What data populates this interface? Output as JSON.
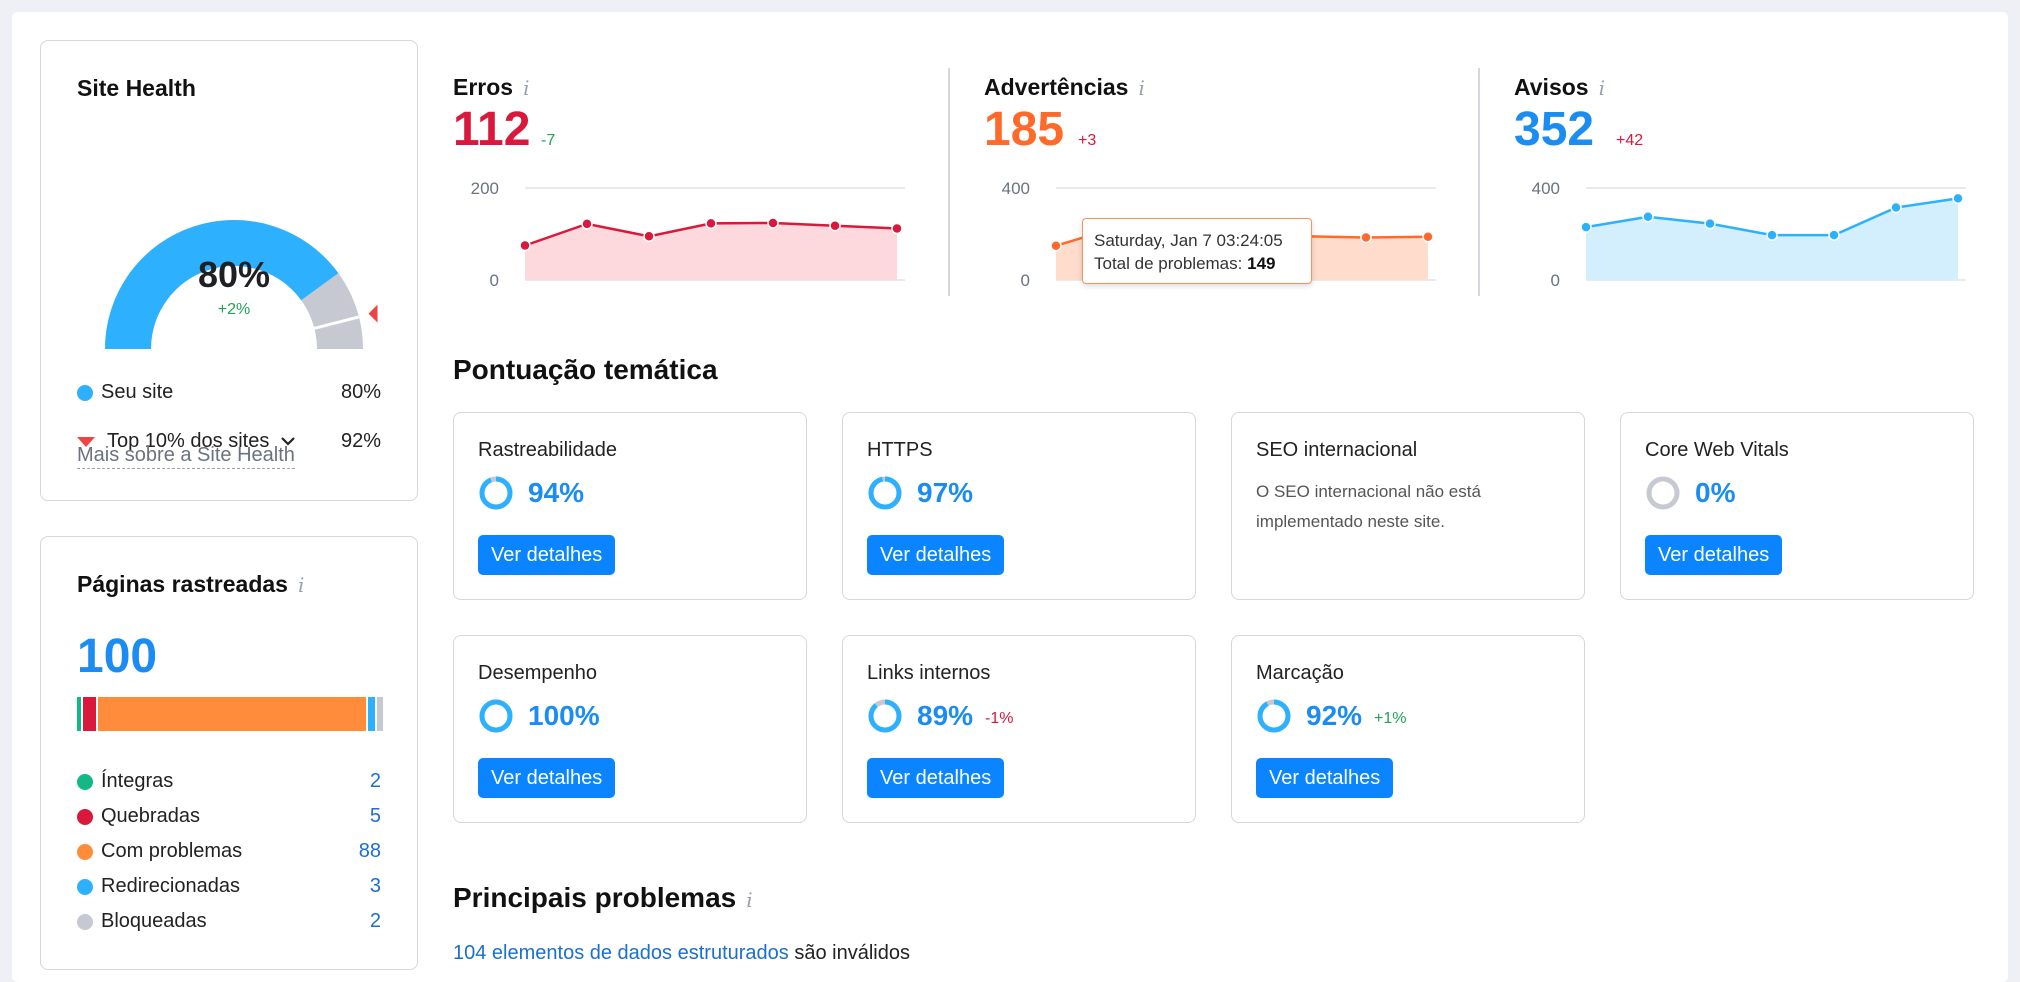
{
  "site_health": {
    "title": "Site Health",
    "score": "80%",
    "delta": "+2%",
    "gauge": {
      "site_fraction": 0.8,
      "top10_fraction": 0.92,
      "color_site": "#2db1ff",
      "color_rest": "#c6c9d2",
      "marker_color": "#ef4444"
    },
    "legend": [
      {
        "label": "Seu site",
        "value": "80%",
        "color": "#2db1ff"
      },
      {
        "label": "Top 10% dos sites",
        "value": "92%",
        "color": "#ef4444"
      }
    ],
    "more_link": "Mais sobre a Site Health"
  },
  "crawled": {
    "title": "Páginas rastreadas",
    "count": "100",
    "items": [
      {
        "label": "Íntegras",
        "value": "2",
        "color": "#12b886"
      },
      {
        "label": "Quebradas",
        "value": "5",
        "color": "#d9183b"
      },
      {
        "label": "Com problemas",
        "value": "88",
        "color": "#ff8c3b"
      },
      {
        "label": "Redirecionadas",
        "value": "3",
        "color": "#2db1ff"
      },
      {
        "label": "Bloqueadas",
        "value": "2",
        "color": "#c6c9d2"
      }
    ]
  },
  "metrics": [
    {
      "title": "Erros",
      "value": "112",
      "delta": "-7",
      "color": "#d9183b",
      "delta_color": "#23a05a"
    },
    {
      "title": "Advertências",
      "value": "185",
      "delta": "+3",
      "color": "#ff6a2b",
      "delta_color": "#d9183b"
    },
    {
      "title": "Avisos",
      "value": "352",
      "delta": "+42",
      "color": "#1b8cf2",
      "delta_color": "#d9183b"
    }
  ],
  "chart_data": [
    {
      "type": "area",
      "title": "Erros",
      "y_ticks": [
        "200",
        "0"
      ],
      "ylim": [
        0,
        200
      ],
      "values": [
        75,
        122,
        95,
        123,
        124,
        118,
        112
      ],
      "color": "#d9183b",
      "fill": "#fdd8dd"
    },
    {
      "type": "area",
      "title": "Advertências",
      "y_ticks": [
        "400",
        "0"
      ],
      "ylim": [
        0,
        400
      ],
      "values": [
        149,
        230,
        200,
        195,
        190,
        185,
        188
      ],
      "color": "#ff6a2b",
      "fill": "#ffdccb"
    },
    {
      "type": "area",
      "title": "Avisos",
      "y_ticks": [
        "400",
        "0"
      ],
      "ylim": [
        0,
        400
      ],
      "values": [
        230,
        275,
        245,
        195,
        195,
        315,
        355
      ],
      "color": "#2db1ff",
      "fill": "#d3eefc"
    }
  ],
  "tooltip": {
    "date": "Saturday, Jan 7 03:24:05",
    "label": "Total de problemas:",
    "value": "149"
  },
  "thematic": {
    "title": "Pontuação temática",
    "button_label": "Ver detalhes",
    "cards": [
      {
        "name": "Rastreabilidade",
        "pct": "94%",
        "fraction": 0.94,
        "delta": ""
      },
      {
        "name": "HTTPS",
        "pct": "97%",
        "fraction": 0.97,
        "delta": ""
      },
      {
        "name": "SEO internacional",
        "note": "O SEO internacional não está implementado neste site."
      },
      {
        "name": "Core Web Vitals",
        "pct": "0%",
        "fraction": 0.0,
        "delta": ""
      },
      {
        "name": "Desempenho",
        "pct": "100%",
        "fraction": 1.0,
        "delta": ""
      },
      {
        "name": "Links internos",
        "pct": "89%",
        "fraction": 0.89,
        "delta": "-1%",
        "delta_color": "#d9183b"
      },
      {
        "name": "Marcação",
        "pct": "92%",
        "fraction": 0.92,
        "delta": "+1%",
        "delta_color": "#23a05a"
      }
    ]
  },
  "problems": {
    "title": "Principais problemas",
    "link_text": "104 elementos de dados estruturados",
    "rest_text": "são inválidos"
  }
}
